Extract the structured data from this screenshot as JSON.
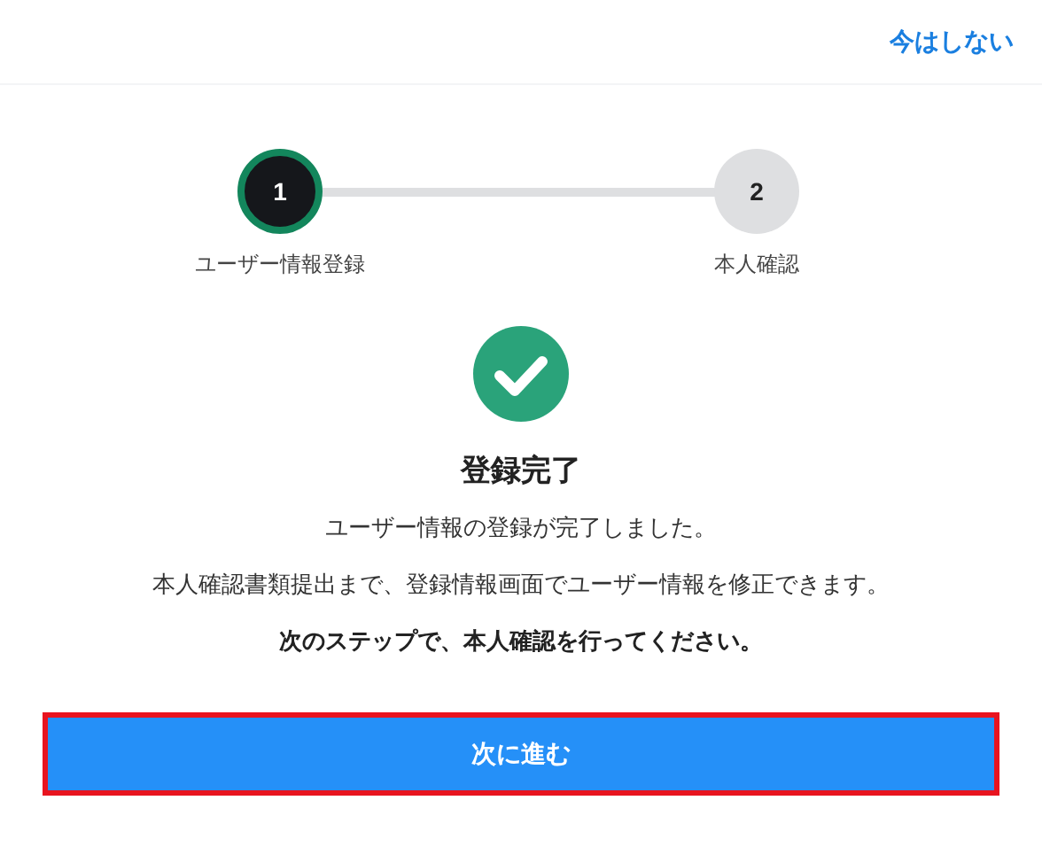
{
  "header": {
    "skip_link": "今はしない"
  },
  "stepper": {
    "steps": [
      {
        "number": "1",
        "label": "ユーザー情報登録",
        "selected": true
      },
      {
        "number": "2",
        "label": "本人確認",
        "selected": false
      }
    ]
  },
  "result": {
    "title": "登録完了",
    "messages": [
      {
        "text": "ユーザー情報の登録が完了しました。",
        "bold": false
      },
      {
        "text": "本人確認書類提出まで、登録情報画面でユーザー情報を修正できます。",
        "bold": false
      },
      {
        "text": "次のステップで、本人確認を行ってください。",
        "bold": true
      }
    ]
  },
  "next_button": {
    "label": "次に進む",
    "highlighted": true
  }
}
